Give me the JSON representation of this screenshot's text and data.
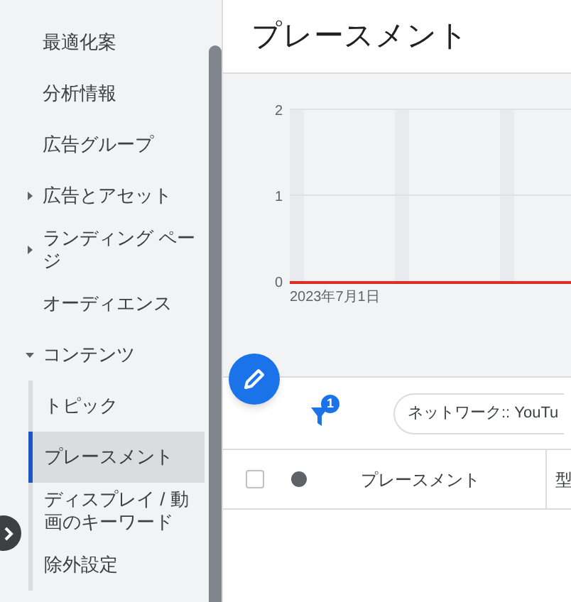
{
  "sidebar": {
    "items": [
      {
        "label": "最適化案",
        "kind": "item",
        "selected": false
      },
      {
        "label": "分析情報",
        "kind": "item",
        "selected": false
      },
      {
        "label": "広告グループ",
        "kind": "item",
        "selected": false
      },
      {
        "label": "広告とアセット",
        "kind": "group",
        "expanded": false,
        "selected": false
      },
      {
        "label": "ランディング ページ",
        "kind": "group",
        "expanded": false,
        "selected": false
      },
      {
        "label": "オーディエンス",
        "kind": "item",
        "selected": false
      },
      {
        "label": "コンテンツ",
        "kind": "group",
        "expanded": true,
        "selected": false,
        "children": [
          {
            "label": "トピック",
            "selected": false
          },
          {
            "label": "プレースメント",
            "selected": true
          },
          {
            "label": "ディスプレイ / 動画のキーワード",
            "selected": false
          },
          {
            "label": "除外設定",
            "selected": false
          }
        ]
      }
    ]
  },
  "page": {
    "title": "プレースメント"
  },
  "chart": {
    "y_labels": [
      "2",
      "1",
      "0"
    ],
    "date_label": "2023年7月1日"
  },
  "filter": {
    "badge": "1",
    "chip": "ネットワーク:: YouTu"
  },
  "table": {
    "select_all_checked": false,
    "columns": [
      "プレースメント",
      "型"
    ]
  }
}
